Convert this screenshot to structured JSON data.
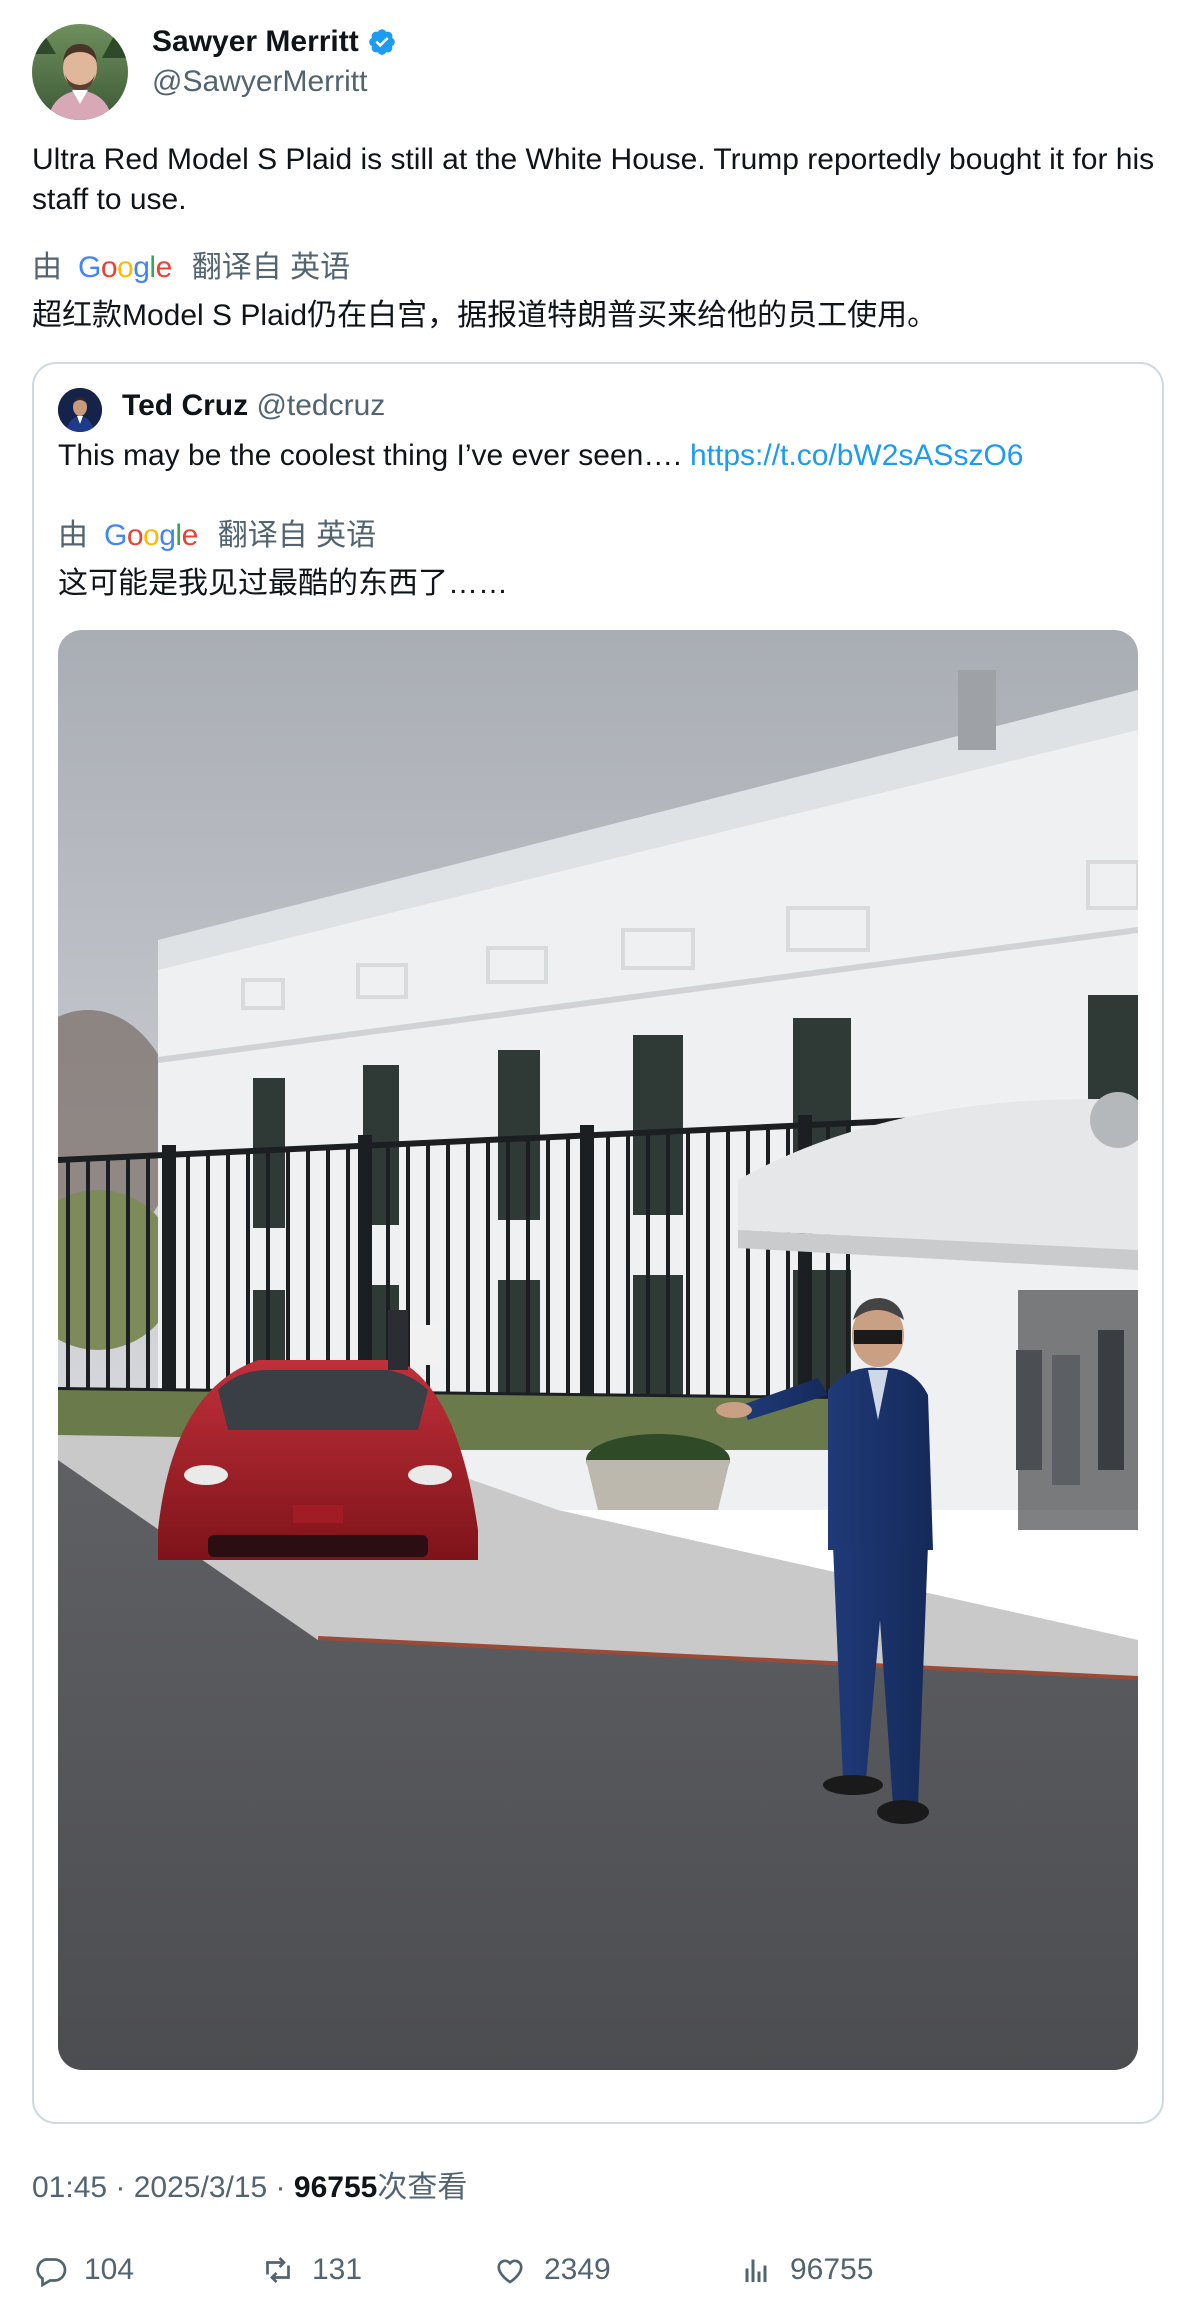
{
  "author": {
    "name": "Sawyer Merritt",
    "handle": "@SawyerMerritt"
  },
  "tweet": {
    "text": "Ultra Red Model S Plaid is still at the White House. Trump reportedly bought it for his staff to use.",
    "translation": {
      "by_label": "由",
      "provider": "Google",
      "from_label": "翻译自 英语",
      "text": "超红款Model S Plaid仍在白宫，据报道特朗普买来给他的员工使用。"
    }
  },
  "quote": {
    "name": "Ted Cruz",
    "handle": "@tedcruz",
    "text": "This may be the coolest thing I’ve ever seen….",
    "link": "https://t.co/bW2sASszO6",
    "translation": {
      "by_label": "由",
      "provider": "Google",
      "from_label": "翻译自 英语",
      "text": "这可能是我见过最酷的东西了……"
    }
  },
  "meta": {
    "time": "01:45",
    "date": "2025/3/15",
    "views": "96755",
    "views_label": "次查看",
    "separator": " · "
  },
  "actions": {
    "replies": "104",
    "reposts": "131",
    "likes": "2349",
    "views": "96755"
  },
  "colors": {
    "link": "#1d9bf0",
    "muted": "#536471",
    "verified": "#1d9bf0",
    "border": "#cfd9de"
  },
  "icons": [
    "verified-badge-icon",
    "reply-icon",
    "repost-icon",
    "like-icon",
    "views-icon"
  ]
}
